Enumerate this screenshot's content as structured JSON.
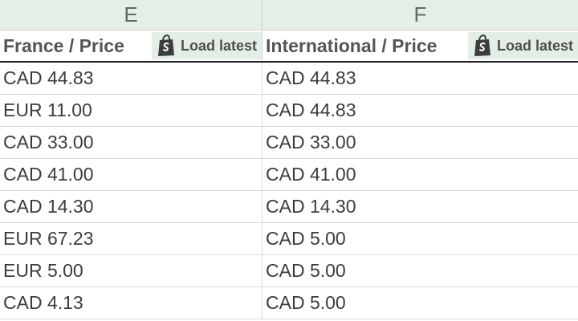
{
  "columns": {
    "e": "E",
    "f": "F"
  },
  "headers": {
    "e": {
      "title": "France / Price",
      "button": "Load latest",
      "icon": "shopify-bag-icon"
    },
    "f": {
      "title": "International / Price",
      "button": "Load latest",
      "icon": "shopify-bag-icon"
    }
  },
  "rows": [
    {
      "e": "CAD 44.83",
      "f": "CAD 44.83"
    },
    {
      "e": "EUR 11.00",
      "f": "CAD 44.83"
    },
    {
      "e": "CAD 33.00",
      "f": "CAD 33.00"
    },
    {
      "e": "CAD 41.00",
      "f": "CAD 41.00"
    },
    {
      "e": "CAD 14.30",
      "f": "CAD 14.30"
    },
    {
      "e": "EUR 67.23",
      "f": "CAD 5.00"
    },
    {
      "e": "EUR 5.00",
      "f": "CAD 5.00"
    },
    {
      "e": "CAD 4.13",
      "f": "CAD 5.00"
    }
  ]
}
